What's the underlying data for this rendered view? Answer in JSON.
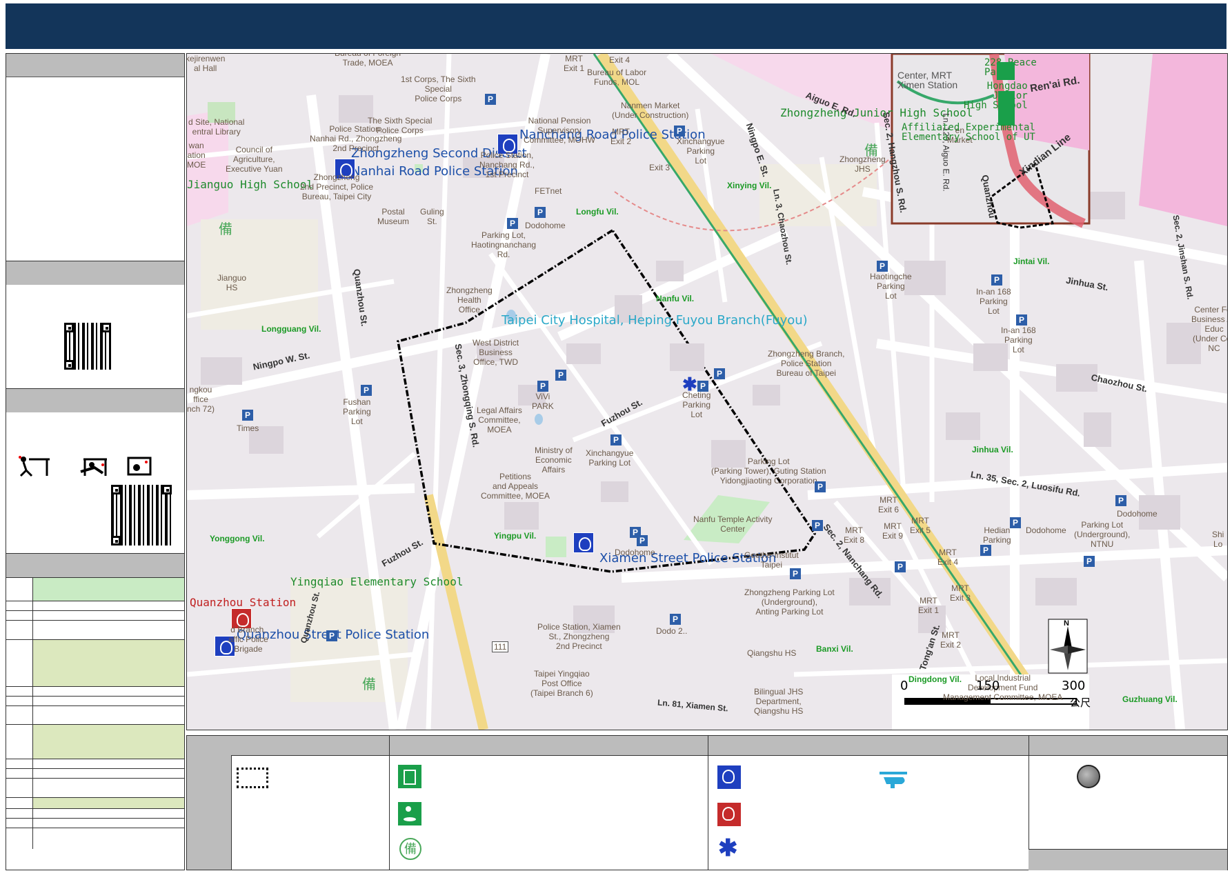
{
  "map": {
    "district_labels": {
      "zhongzheng_second_district": "Zhongzheng Second District",
      "nanhai_road_police": "Nanhai Road Police Station",
      "nanchang_road_police": "Nanchang Road Police Station",
      "xiamen_street_police": "Xiamen Street Police Station",
      "quanzhou_street_police": "Quanzhou Street Police Station",
      "taipei_city_hospital": "Taipei City Hospital, Heping Fuyou Branch(Fuyou)",
      "jianguo_high_school": "Jianguo High School",
      "zhongzheng_junior_high": "Zhongzheng Junior High School",
      "yingqiao_elementary": "Yingqiao Elementary School",
      "quanzhou_station": "Quanzhou Station"
    },
    "villages": [
      "Longfu Vil.",
      "Xinying Vil.",
      "Nanfu Vil.",
      "Longguang Vil.",
      "Yonggong Vil.",
      "Yingpu Vil.",
      "Banxi Vil.",
      "Dingdong Vil.",
      "Jinhua Vil.",
      "Jintai Vil.",
      "Guzhuang Vil."
    ],
    "streets": {
      "aiguo": "Aiguo E. Rd.",
      "ningpo_e": "Ningpo E. St.",
      "hangzhou": "Sec. 2, Hangzhou S. Rd.",
      "ln120": "Ln. 120, Aiguo E. Rd.",
      "chaozhou_ln3": "Ln. 3, Chaozhou St.",
      "ningpo_w": "Ningpo W. St.",
      "quanzhou": "Quanzhou St.",
      "zhongqing": "Sec. 3, Zhongqing S. Rd.",
      "fuzhou": "Fuzhou St.",
      "fuzhou2": "Fuzhou St.",
      "nanchang": "Sec. 2, Nanchang Rd.",
      "tongan": "Tong'an St.",
      "luosifu": "Ln. 35, Sec. 2, Luosifu Rd.",
      "chaozhou": "Chaozhou St.",
      "jinhua": "Jinhua St.",
      "jinshan": "Sec. 2, Jinshan S. Rd.",
      "xiamen": "Ln. 81, Xiamen St.",
      "quanzhou2": "Quanzhou St."
    },
    "poi": {
      "trade_moea": "Bureau of Foreign\nTrade, MOEA",
      "first_corps": "1st Corps, The Sixth\nSpecial\nPolice Corps",
      "sixth_special": "The Sixth Special\nPolice Corps",
      "labor_funds": "Bureau of Labor\nFunds, MOL",
      "nanmen_market": "Nanmen Market\n(Under Construction)",
      "pension": "National Pension\nSupervisory\nCommittee, MOHW",
      "mrt_exit1_top": "MRT\nExit 1",
      "exit4_top": "Exit 4",
      "mrt_exit2_top": "MRT\nExit 2",
      "exit3_top": "Exit 3",
      "xinchangyue_lot": "Xinchangyue\nParking\nLot",
      "national_library": "d Site, National\nentral Library",
      "nanhai_police_lbl": "Police Station,\nNanhai Rd., Zhongzheng\n2nd Precinct",
      "council_agri": "Council of\nAgriculture,\nExecutive Yuan",
      "zhongzheng_2nd_bureau": "Zhongzheng\n2nd Precinct, Police\nBureau, Taipei City",
      "nanchang_police_lbl": "Police Station,\nNanchang Rd.,\n1st Precinct",
      "fetnet": "FETnet",
      "postal_museum": "Postal\nMuseum",
      "guling": "Guling\nSt.",
      "dodohome1": "Dodohome",
      "parking_haoting": "Parking Lot,\nHaotingnanchang\nRd.",
      "jianguo_hs": "Jianguo\nHS",
      "zhongzheng_health": "Zhongzheng\nHealth\nOffice",
      "west_district": "West District\nBusiness\nOffice, TWD",
      "vivi_park": "ViVi\nPARK",
      "legal_affairs": "Legal Affairs\nCommittee,\nMOEA",
      "economic_affairs": "Ministry of\nEconomic\nAffairs",
      "petitions": "Petitions\nand Appeals\nCommittee, MOEA",
      "fushan_lot": "Fushan\nParking\nLot",
      "times": "Times",
      "xinchangyue_parking": "Xinchangyue\nParking Lot",
      "cheting": "Cheting\nParking\nLot",
      "zhongzheng_branch": "Zhongzheng Branch,\nPolice Station\nBureau of Taipei",
      "zhongzheng_jhs": "Zhongzheng\nJHS",
      "market": "en\nMarket",
      "haoting_lot": "Haotingche\nParking\nLot",
      "inan_168a": "In-an 168\nParking\nLot",
      "inan_168b": "In-an 168\nParking\nLot",
      "center_for": "Center For\nBusiness Ad\nEduc\n(Under Con\nNC",
      "parking_tower": "Parking Lot\n(Parking Tower), Guting Station\nYidongjiaoting Corporation",
      "nanfu_temple": "Nanfu Temple Activity\nCenter",
      "dodohome2": "Dodohome",
      "goethe": "Goethe-Institut\nTaipei",
      "zhongzheng_parking": "Zhongzheng Parking Lot\n(Underground),\nAnting Parking Lot",
      "qiangshu_hs": "Qiangshu HS",
      "bilingual": "Bilingual JHS\nDepartment,\nQiangshu HS",
      "mrt_exit6": "MRT\nExit 6",
      "mrt_exit8": "MRT\nExit 8",
      "exit9": "MRT\nExit 9",
      "mrt_exit5": "MRT\nExit 5",
      "mrt_exit4": "MRT\nExit 4",
      "mrt_exit3": "MRT\nExit 3",
      "mrt_exit1": "MRT\nExit 1",
      "mrt_exit2": "MRT\nExit 2",
      "hedian": "Hedian\nParking",
      "dodohome3": "Dodohome",
      "ntnu_parking": "Parking Lot\n(Underground),\nNTNU",
      "dodohome4": "Dodohome",
      "local_industrial": "Local Industrial\nDevelopment Fund\nManagement Committee, MOEA",
      "xiamen_police_lbl": "Police Station, Xiamen\nSt., Zhongzheng\n2nd Precinct",
      "yingqiao_post": "Taipei Yingqiao\nPost Office\n(Taipei Branch 6)",
      "quanzhou_branch": "d Branch,\naffic Police\nBrigade",
      "kejirenwen": "kejirenwen\nal Hall",
      "wan_station": "wan\nation\nMOE",
      "jingkou": "ngkou\nffice\nnch 72)",
      "road_111": "111",
      "dodo_bottom": "Dodo 2..",
      "shi_lo": "Shi\nLo"
    },
    "inset": {
      "peace_park": "228 Peace\nPark",
      "ximen_station": "Center, MRT\nXimen Station",
      "hongdao": "Hongdao\nJunior\nHigh School",
      "affiliated": "Affiliated Experimental\nElementary School of UT",
      "renai": "Ren'ai Rd.",
      "xindian_line": "Xindian Line",
      "quanzhou_inset": "Quanzhou",
      "center_mrt": "Center, MRT"
    },
    "scale": {
      "zero": "0",
      "mid": "150",
      "max": "300",
      "unit": "公尺"
    },
    "north_label": "N"
  },
  "legend": {
    "shelter_icon_char": "備"
  },
  "colors": {
    "title_bar": "#13355a",
    "table_green": "#c9ebc4",
    "table_olive": "#dce8be",
    "route": "#000000",
    "police_blue": "#1e3fbf",
    "evac_green": "#1a9f4a"
  }
}
